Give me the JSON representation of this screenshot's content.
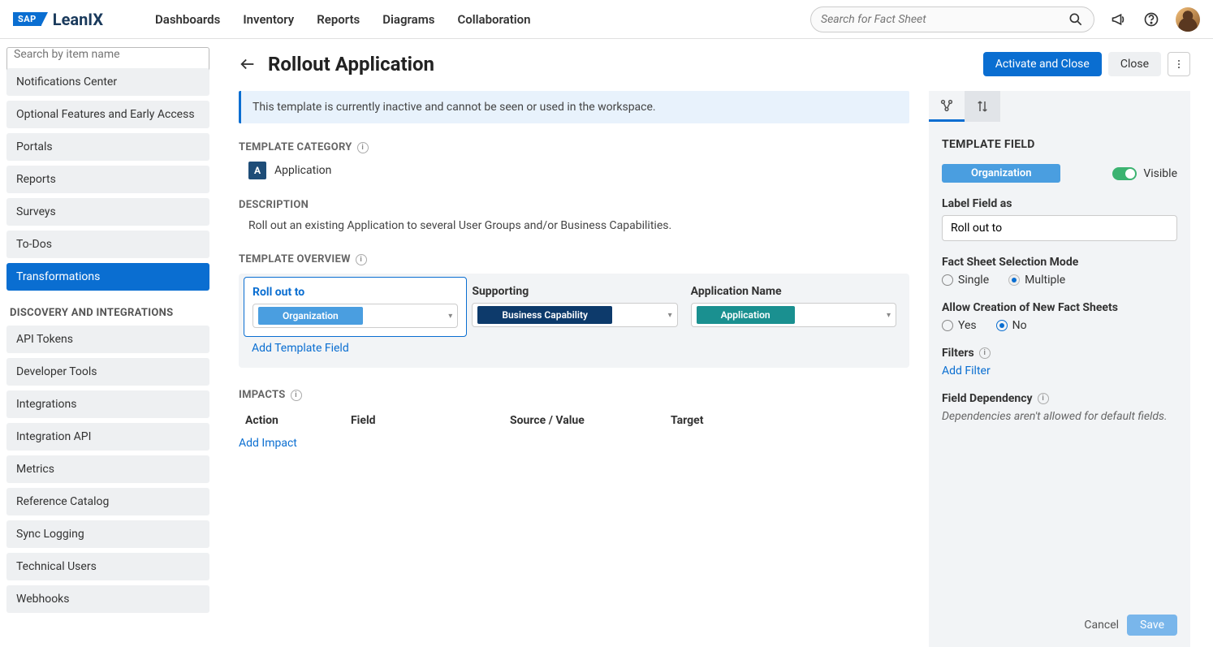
{
  "header": {
    "logo_sap": "SAP",
    "logo_leanix": "LeanIX",
    "nav": [
      "Dashboards",
      "Inventory",
      "Reports",
      "Diagrams",
      "Collaboration"
    ],
    "search_placeholder": "Search for Fact Sheet"
  },
  "sidebar": {
    "search_placeholder": "Search by item name",
    "items_top": [
      "Notifications Center",
      "Optional Features and Early Access",
      "Portals",
      "Reports",
      "Surveys",
      "To-Dos",
      "Transformations"
    ],
    "active_index": 6,
    "section_label": "DISCOVERY AND INTEGRATIONS",
    "items_bottom": [
      "API Tokens",
      "Developer Tools",
      "Integrations",
      "Integration API",
      "Metrics",
      "Reference Catalog",
      "Sync Logging",
      "Technical Users",
      "Webhooks"
    ]
  },
  "page": {
    "title": "Rollout Application",
    "activate_btn": "Activate and Close",
    "close_btn": "Close",
    "banner": "This template is currently inactive and cannot be seen or used in the workspace.",
    "template_category_label": "TEMPLATE CATEGORY",
    "category_badge": "A",
    "category_name": "Application",
    "description_label": "DESCRIPTION",
    "description_text": "Roll out an existing Application to several User Groups and/or Business Capabilities.",
    "overview_label": "TEMPLATE OVERVIEW",
    "overview": [
      {
        "label": "Roll out to",
        "chip": "Organization",
        "chip_class": "org",
        "selected": true
      },
      {
        "label": "Supporting",
        "chip": "Business Capability",
        "chip_class": "bc",
        "selected": false
      },
      {
        "label": "Application Name",
        "chip": "Application",
        "chip_class": "app",
        "selected": false
      }
    ],
    "add_template_field": "Add Template Field",
    "impacts_label": "IMPACTS",
    "impacts_columns": {
      "action": "Action",
      "field": "Field",
      "source": "Source / Value",
      "target": "Target"
    },
    "add_impact": "Add Impact"
  },
  "right_panel": {
    "title": "TEMPLATE FIELD",
    "chip": "Organization",
    "visible_label": "Visible",
    "label_field_as": "Label Field as",
    "label_value": "Roll out to",
    "selection_mode_label": "Fact Sheet Selection Mode",
    "selection_single": "Single",
    "selection_multiple": "Multiple",
    "selection_value": "Multiple",
    "allow_create_label": "Allow Creation of New Fact Sheets",
    "allow_yes": "Yes",
    "allow_no": "No",
    "allow_value": "No",
    "filters_label": "Filters",
    "add_filter": "Add Filter",
    "field_dep_label": "Field Dependency",
    "field_dep_text": "Dependencies aren't allowed for default fields.",
    "cancel": "Cancel",
    "save": "Save"
  }
}
